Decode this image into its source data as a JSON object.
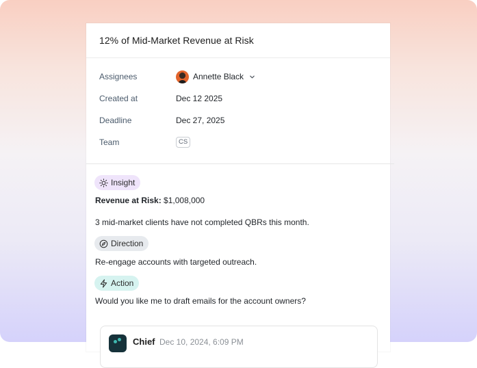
{
  "task": {
    "title": "12% of Mid-Market Revenue at Risk"
  },
  "properties": {
    "assignees_label": "Assignees",
    "assignee_name": "Annette Black",
    "created_label": "Created at",
    "created_value": "Dec 12 2025",
    "deadline_label": "Deadline",
    "deadline_value": "Dec 27, 2025",
    "team_label": "Team",
    "team_value": "CS"
  },
  "insight": {
    "tag": "Insight",
    "revenue_label": "Revenue at Risk:",
    "revenue_value": "$1,008,000",
    "summary": "3 mid-market clients have not completed QBRs this month."
  },
  "direction": {
    "tag": "Direction",
    "text": "Re-engage accounts with targeted outreach."
  },
  "action": {
    "tag": "Action",
    "text": "Would you like me to draft emails for the account owners?"
  },
  "agent_message": {
    "name": "Chief",
    "timestamp": "Dec 10, 2024, 6:09 PM"
  },
  "colors": {
    "insight_pill": "#efe4fb",
    "direction_pill": "#e7eaee",
    "action_pill": "#d6f3f0",
    "accent_teal": "#3fb9b0"
  },
  "icons": {
    "insight": "sun-icon",
    "direction": "compass-icon",
    "action": "lightning-icon",
    "assignee_dropdown": "chevron-down-icon"
  }
}
